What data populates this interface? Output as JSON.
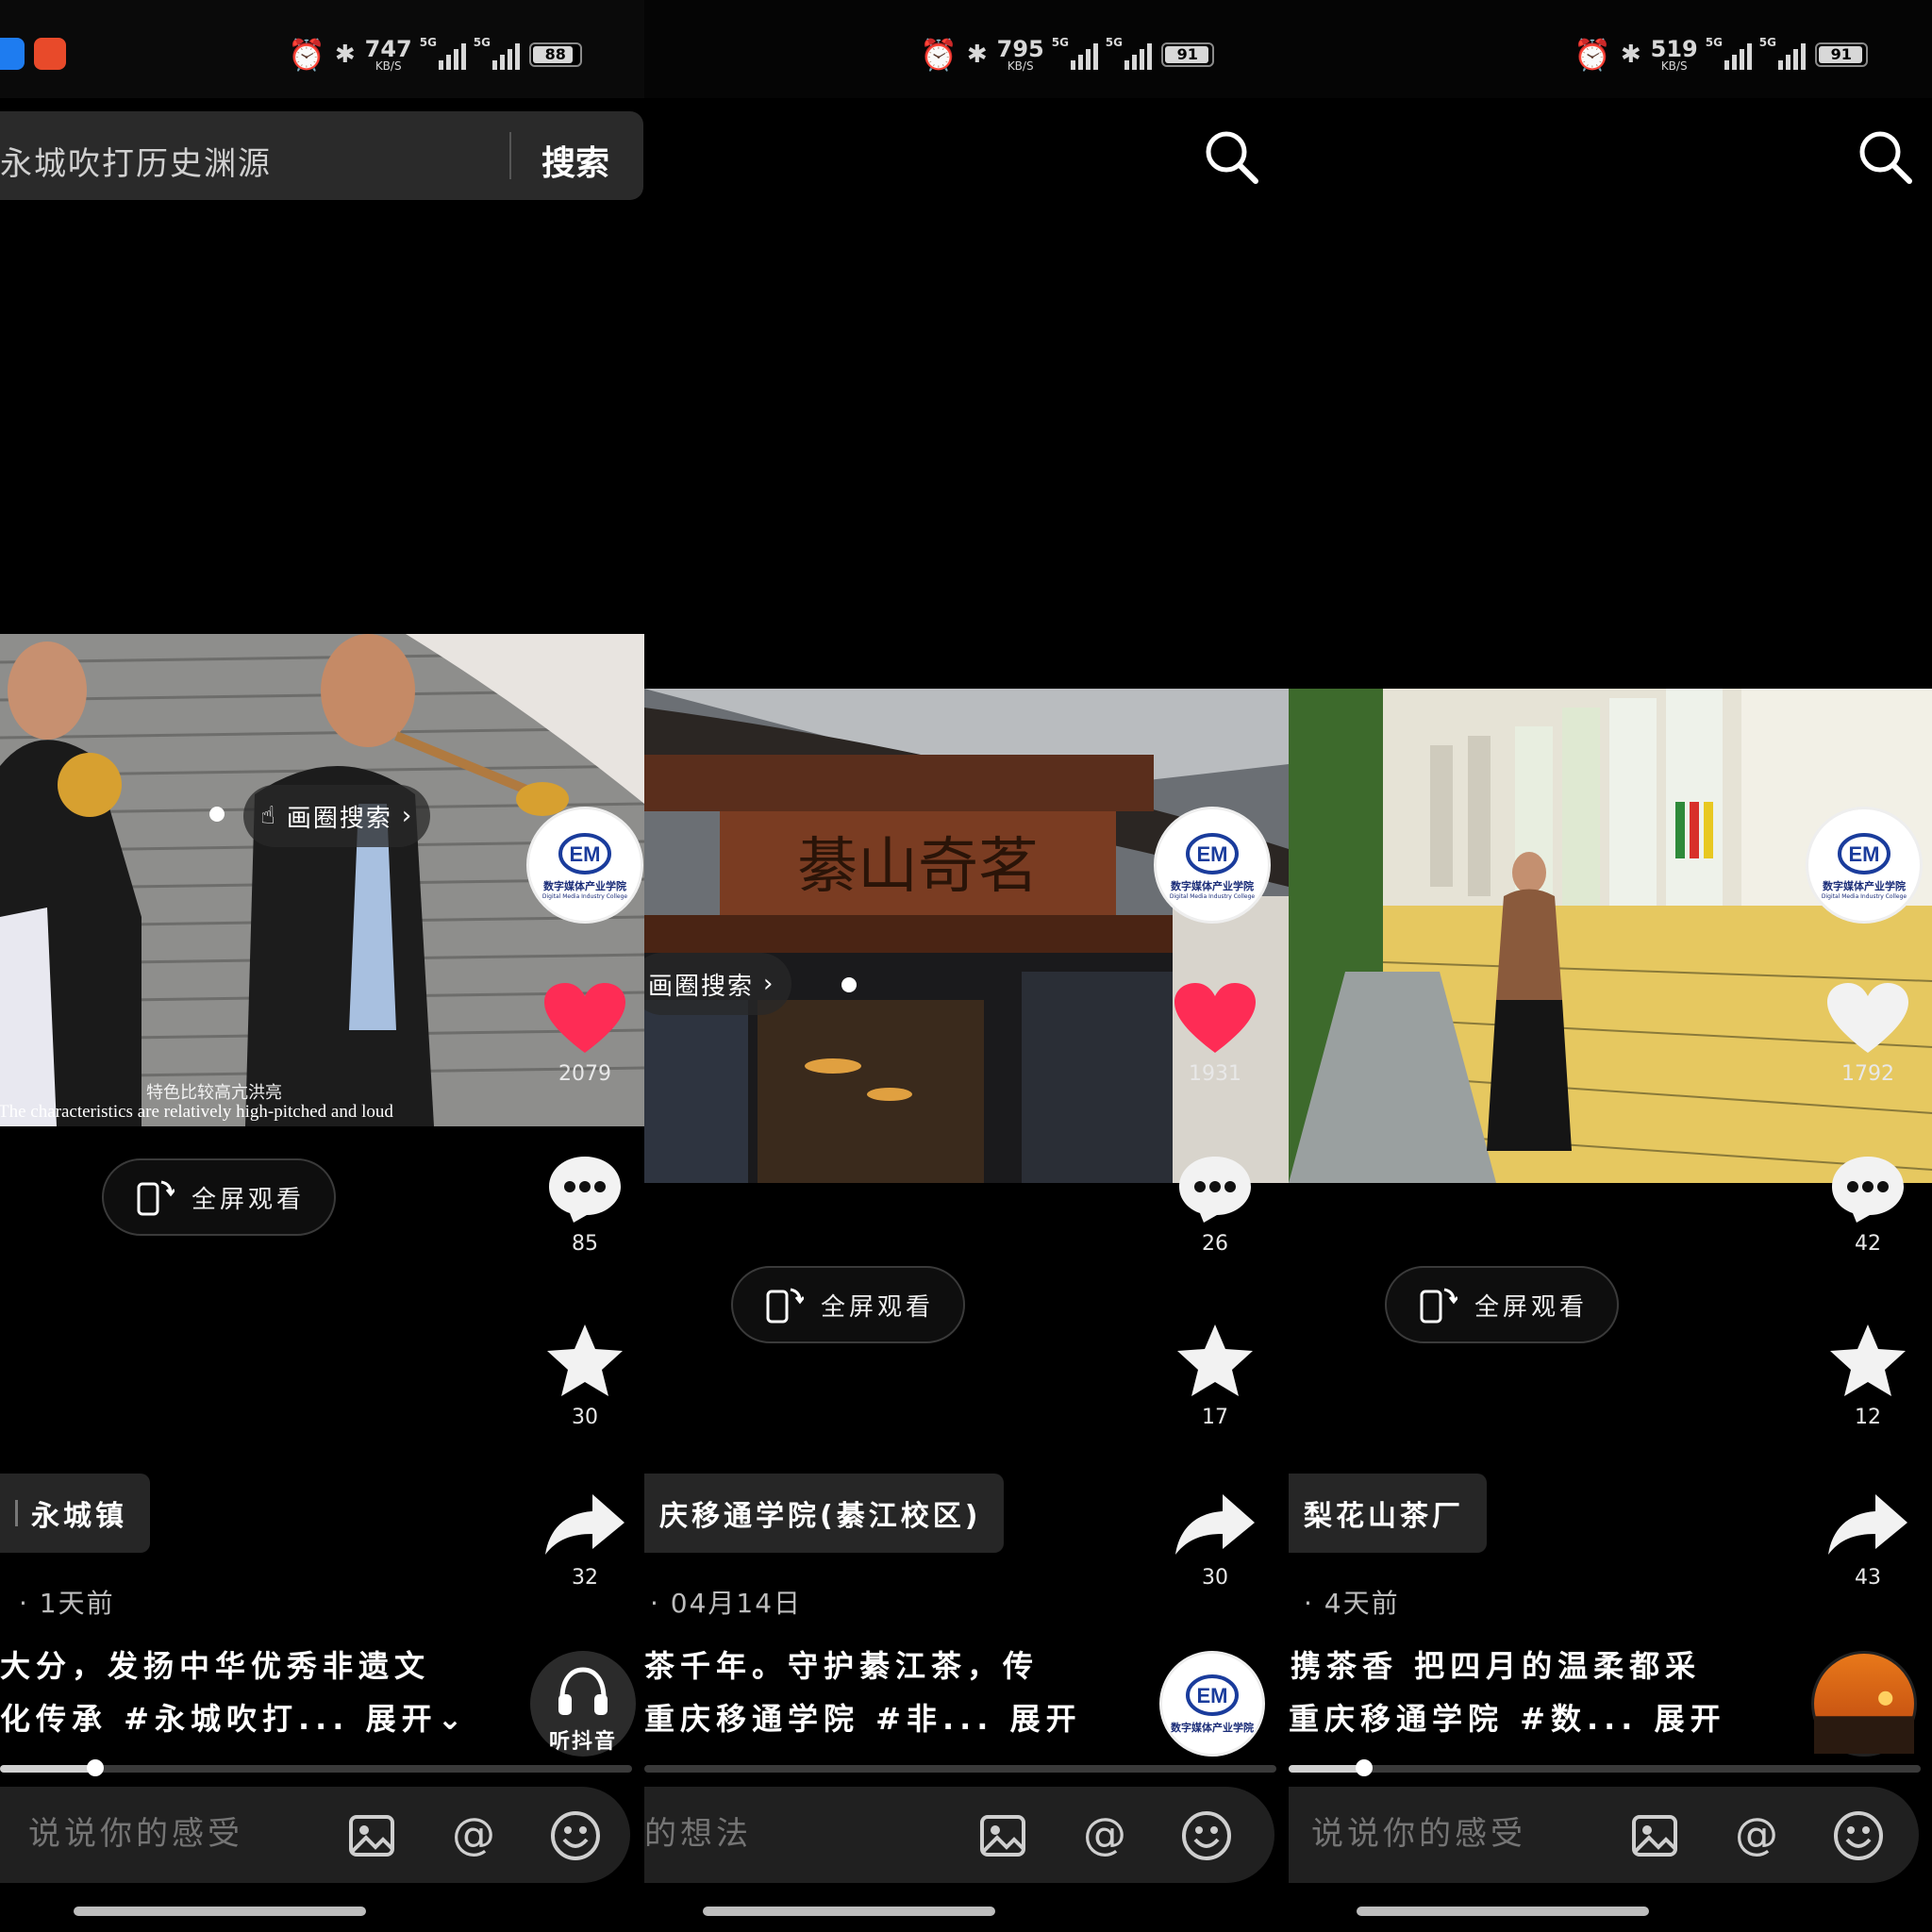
{
  "colors": {
    "like_active": "#fe2c55",
    "like_inactive": "#f2f2f2",
    "background": "#000000",
    "avatar_brand": "#1a3c9c"
  },
  "panels": [
    {
      "status": {
        "speed": "747",
        "speed_unit": "KB/S",
        "net1": "5G",
        "net2": "5G",
        "battery": "88"
      },
      "search": {
        "query": "永城吹打历史渊源",
        "button": "搜索"
      },
      "lens_search": "画圈搜索",
      "subtitle_cn": "特色比较高亢洪亮",
      "subtitle_en": "The characteristics are relatively high-pitched and loud",
      "avatar": {
        "name": "数字媒体产业学院",
        "name_en": "Digital Media Industry College"
      },
      "like": {
        "count": "2079",
        "liked": true
      },
      "comments": "85",
      "favorites": "30",
      "shares": "32",
      "fullscreen": "全屏观看",
      "location": "永城镇",
      "date": "· 1天前",
      "caption_line1": "大分，发扬中华优秀非遗文",
      "caption_line2": "化传承 #永城吹打...",
      "more": "展开",
      "listen": "听抖音",
      "progress": 0.15,
      "comment_placeholder": "说说你的感受"
    },
    {
      "status": {
        "speed": "795",
        "speed_unit": "KB/S",
        "net1": "5G",
        "net2": "5G",
        "battery": "91"
      },
      "lens_search": "画圈搜索",
      "sign_text": "綦山奇茗",
      "avatar": {
        "name": "数字媒体产业学院",
        "name_en": "Digital Media Industry College"
      },
      "like": {
        "count": "1931",
        "liked": true
      },
      "comments": "26",
      "favorites": "17",
      "shares": "30",
      "fullscreen": "全屏观看",
      "location": "庆移通学院(綦江校区)",
      "date": "· 04月14日",
      "caption_line1": "茶千年。守护綦江茶，传",
      "caption_line2": "重庆移通学院 #非...",
      "more": "展开",
      "progress": 0.0,
      "comment_placeholder": "的想法"
    },
    {
      "status": {
        "speed": "519",
        "speed_unit": "KB/S",
        "net1": "5G",
        "net2": "5G",
        "battery": "91"
      },
      "avatar": {
        "name": "数字媒体产业学院",
        "name_en": "Digital Media Industry College"
      },
      "like": {
        "count": "1792",
        "liked": false
      },
      "comments": "42",
      "favorites": "12",
      "shares": "43",
      "fullscreen": "全屏观看",
      "location": "梨花山茶厂",
      "date": "· 4天前",
      "caption_line1": "携茶香 把四月的温柔都采",
      "caption_line2": "重庆移通学院 #数...",
      "more": "展开",
      "progress": 0.12,
      "comment_placeholder": "说说你的感受"
    }
  ]
}
